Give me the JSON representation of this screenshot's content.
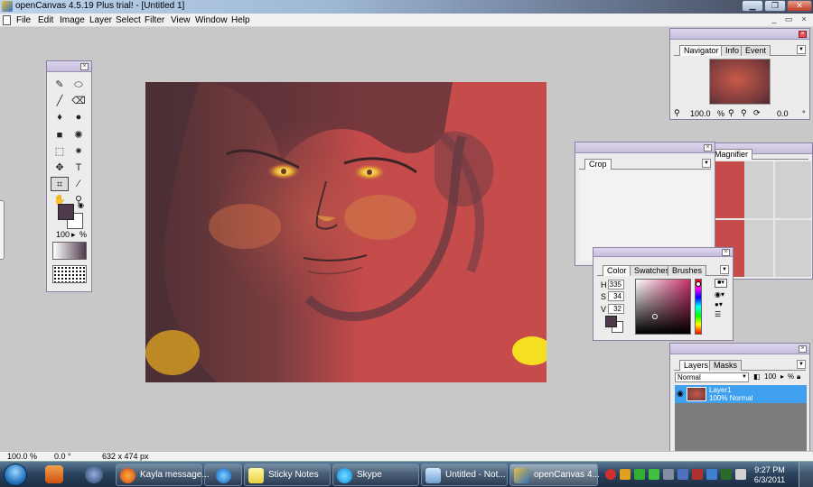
{
  "window": {
    "title": "openCanvas 4.5.19 Plus trial! - [Untitled 1]",
    "min_glyph": "▁",
    "max_glyph": "❐",
    "close_glyph": "✕",
    "inner_min_glyph": "_",
    "inner_max_glyph": "▭",
    "inner_close_glyph": "×"
  },
  "menu": [
    "File",
    "Edit",
    "Image",
    "Layer",
    "Select",
    "Filter",
    "View",
    "Window",
    "Help"
  ],
  "tools": {
    "zoom_value": "100",
    "zoom_unit": "%"
  },
  "navigator": {
    "tabs": [
      "Navigator",
      "Info",
      "Event"
    ],
    "zoom": "100.0",
    "zoom_unit": "%",
    "rotation": "0.0",
    "rotation_unit": "°"
  },
  "crop": {
    "tabs": [
      "Crop"
    ]
  },
  "magnifier": {
    "tabs": [
      "Magnifier"
    ]
  },
  "color": {
    "tabs": [
      "Color",
      "Swatches",
      "Brushes"
    ],
    "h_label": "H",
    "h_value": "335",
    "s_label": "S",
    "s_value": "34",
    "v_label": "V",
    "v_value": "32",
    "foreground": "#4e3a4a",
    "accent_hue": "#c8306a"
  },
  "layers": {
    "tabs": [
      "Layers",
      "Masks"
    ],
    "blend_mode": "Normal",
    "opacity": "100",
    "opacity_unit": "%",
    "items": [
      {
        "name": "Layer1",
        "detail": "100% Normal"
      }
    ]
  },
  "status": {
    "zoom": "100.0 %",
    "rotation": "0.0 °",
    "size": "632 x 474 px"
  },
  "taskbar": {
    "tasks": [
      {
        "label": "Kayla message..."
      },
      {
        "label": ""
      },
      {
        "label": "Sticky Notes"
      },
      {
        "label": "Skype"
      },
      {
        "label": "Untitled - Not..."
      },
      {
        "label": "openCanvas 4..."
      }
    ],
    "time": "9:27 PM",
    "date": "6/3/2011"
  }
}
